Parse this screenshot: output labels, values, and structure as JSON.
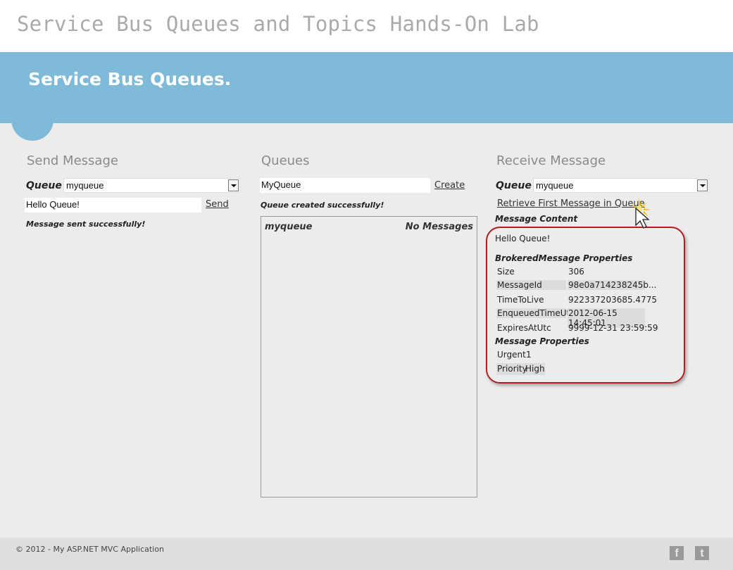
{
  "site_title": "Service Bus Queues and Topics Hands-On Lab",
  "banner_title": "Service Bus Queues.",
  "send": {
    "heading": "Send Message",
    "queue_label": "Queue",
    "queue_value": "myqueue",
    "message_value": "Hello Queue!",
    "send_label": "Send",
    "status": "Message sent successfully!"
  },
  "queues": {
    "heading": "Queues",
    "name_value": "MyQueue",
    "create_label": "Create",
    "status": "Queue created successfully!",
    "list": [
      {
        "name": "myqueue",
        "count": "No Messages"
      }
    ]
  },
  "receive": {
    "heading": "Receive Message",
    "queue_label": "Queue",
    "queue_value": "myqueue",
    "retrieve_label": "Retrieve First Message in Queue",
    "content_heading": "Message Content",
    "content": "Hello Queue!",
    "brokered_heading": "BrokeredMessage Properties",
    "brokered": [
      {
        "key": "Size",
        "value": "306"
      },
      {
        "key": "MessageId",
        "value": "98e0a714238245b..."
      },
      {
        "key": "TimeToLive",
        "value": "922337203685.4775"
      },
      {
        "key": "EnqueuedTimeUtc",
        "value": "2012-06-15 14:45:01"
      },
      {
        "key": "ExpiresAtUtc",
        "value": "9999-12-31 23:59:59"
      }
    ],
    "props_heading": "Message Properties",
    "props": [
      {
        "key": "Urgent",
        "value": "1"
      },
      {
        "key": "Priority",
        "value": "High"
      }
    ]
  },
  "footer": {
    "copyright": "© 2012 - My ASP.NET MVC Application",
    "facebook_glyph": "f",
    "twitter_glyph": "t"
  },
  "colors": {
    "banner": "#7fbbd9",
    "highlight": "#b21e24"
  }
}
